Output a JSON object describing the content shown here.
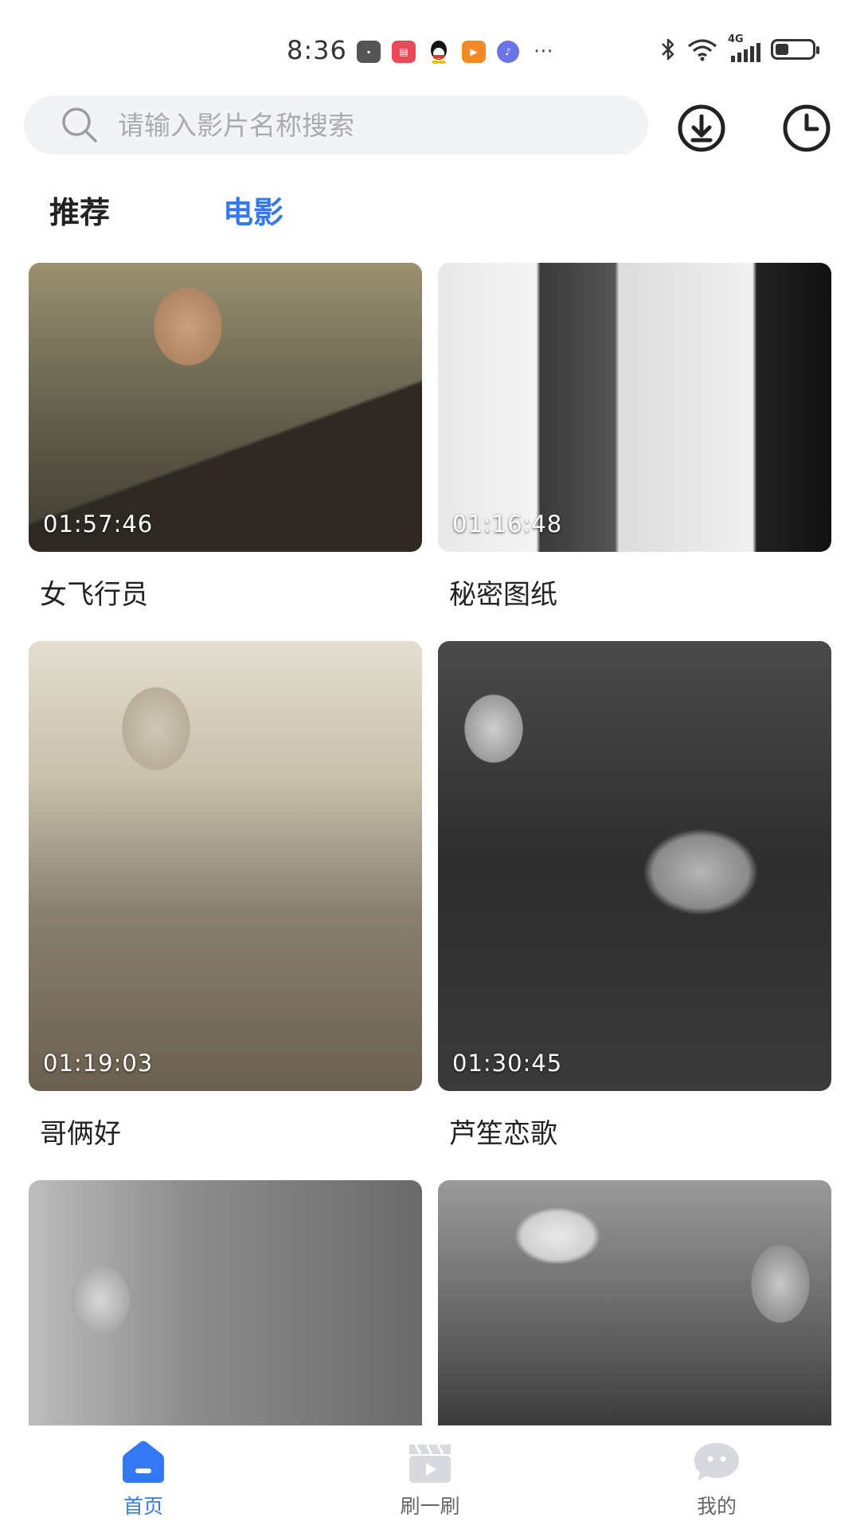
{
  "status_bar": {
    "time": "8:36",
    "network": "4G",
    "app_icons": [
      "huawei-store-icon",
      "book-app-icon",
      "qq-icon",
      "video-app-icon",
      "music-app-icon"
    ],
    "more": "···"
  },
  "search": {
    "placeholder": "请输入影片名称搜索",
    "value": ""
  },
  "header_actions": [
    "download-icon",
    "history-clock-icon"
  ],
  "tabs": [
    {
      "label": "推荐",
      "active": false
    },
    {
      "label": "电影",
      "active": true
    }
  ],
  "movies": [
    {
      "title": "女飞行员",
      "duration": "01:57:46"
    },
    {
      "title": "秘密图纸",
      "duration": "01:16:48"
    },
    {
      "title": "哥俩好",
      "duration": "01:19:03"
    },
    {
      "title": "芦笙恋歌",
      "duration": "01:30:45"
    },
    {
      "title": "",
      "duration": ""
    },
    {
      "title": "",
      "duration": ""
    }
  ],
  "bottom_nav": [
    {
      "label": "首页",
      "icon": "home-icon",
      "active": true
    },
    {
      "label": "刷一刷",
      "icon": "clapperboard-icon",
      "active": false
    },
    {
      "label": "我的",
      "icon": "chat-bubble-icon",
      "active": false
    }
  ],
  "colors": {
    "accent": "#3478f6",
    "search_bg": "#f2f3f5",
    "inactive_icon": "#d7d9de"
  }
}
